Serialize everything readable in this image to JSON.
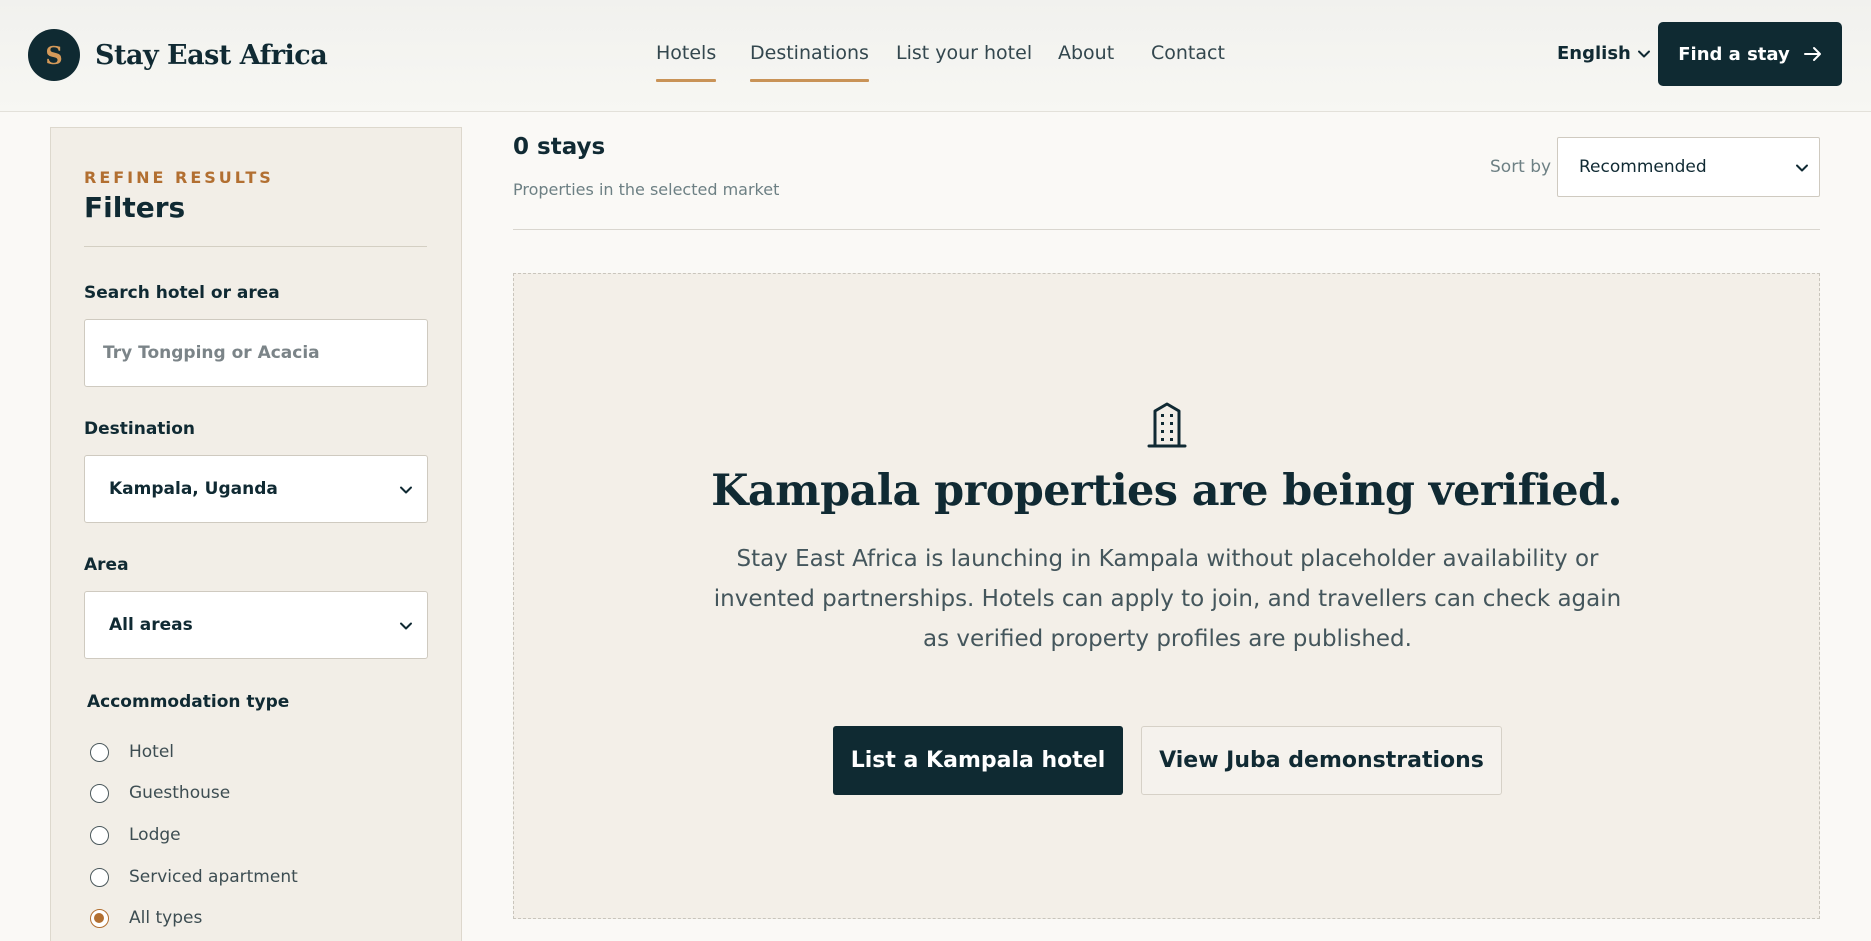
{
  "brand": {
    "mark": "S",
    "name": "Stay East Africa"
  },
  "nav": {
    "items": [
      {
        "label": "Hotels",
        "active": true
      },
      {
        "label": "Destinations",
        "active": true
      },
      {
        "label": "List your hotel",
        "active": false
      },
      {
        "label": "About",
        "active": false
      },
      {
        "label": "Contact",
        "active": false
      }
    ],
    "language": "English",
    "cta_label": "Find a stay"
  },
  "sidebar": {
    "eyebrow": "REFINE RESULTS",
    "title": "Filters",
    "search_label": "Search hotel or area",
    "search_placeholder": "Try Tongping or Acacia",
    "destination_label": "Destination",
    "destination_value": "Kampala, Uganda",
    "area_label": "Area",
    "area_value": "All areas",
    "type_label": "Accommodation type",
    "types": [
      {
        "label": "Hotel",
        "checked": false
      },
      {
        "label": "Guesthouse",
        "checked": false
      },
      {
        "label": "Lodge",
        "checked": false
      },
      {
        "label": "Serviced apartment",
        "checked": false
      },
      {
        "label": "All types",
        "checked": true
      }
    ]
  },
  "results": {
    "count": "0 stays",
    "subtitle": "Properties in the selected market",
    "sort_label": "Sort by",
    "sort_value": "Recommended"
  },
  "empty_state": {
    "icon": "building-icon",
    "title": "Kampala properties are being verified.",
    "body": "Stay East Africa is launching in Kampala without placeholder availability or invented partnerships. Hotels can apply to join, and travellers can check again as verified property profiles are published.",
    "primary_label": "List a Kampala hotel",
    "secondary_label": "View Juba demonstrations"
  },
  "colors": {
    "ink": "#0f2a32",
    "accent": "#c99357",
    "eyebrow": "#b26f31",
    "page_bg": "#faf9f6",
    "panel_bg": "#f3efe8"
  }
}
